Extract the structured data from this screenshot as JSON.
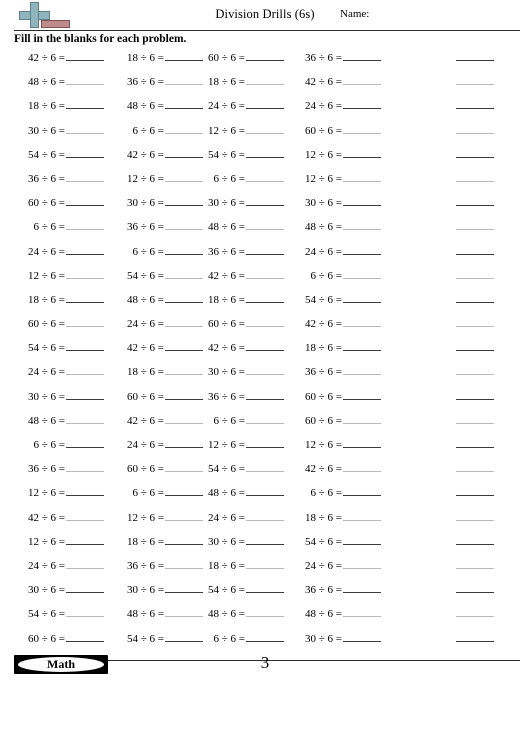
{
  "header": {
    "title": "Division Drills (6s)",
    "name_label": "Name:",
    "logo": {
      "plus_icon": "plus-icon",
      "minus_icon": "minus-icon",
      "plus_color": "#8fb6bd",
      "minus_color": "#c08a8a"
    }
  },
  "instructions": "Fill in the blanks for each problem.",
  "worksheet": {
    "operator": "÷",
    "divisor": 6,
    "columns": 5,
    "rows": 25,
    "column_dividends": [
      [
        42,
        48,
        18,
        30,
        54,
        36,
        60,
        6,
        24,
        12,
        18,
        60,
        54,
        24,
        30,
        48,
        6,
        36,
        12,
        42,
        12,
        24,
        30,
        54,
        60
      ],
      [
        18,
        36,
        48,
        6,
        42,
        12,
        30,
        36,
        6,
        54,
        48,
        24,
        42,
        18,
        60,
        42,
        24,
        60,
        6,
        12,
        18,
        36,
        30,
        48,
        54
      ],
      [
        60,
        18,
        24,
        12,
        54,
        6,
        30,
        48,
        36,
        42,
        18,
        60,
        42,
        30,
        36,
        6,
        12,
        54,
        48,
        24,
        30,
        18,
        54,
        48,
        6
      ],
      [
        36,
        42,
        24,
        60,
        12,
        12,
        30,
        48,
        24,
        6,
        54,
        42,
        18,
        36,
        60,
        60,
        12,
        42,
        6,
        18,
        54,
        24,
        36,
        48,
        30
      ],
      [
        null,
        null,
        null,
        null,
        null,
        null,
        null,
        null,
        null,
        null,
        null,
        null,
        null,
        null,
        null,
        null,
        null,
        null,
        null,
        null,
        null,
        null,
        null,
        null,
        null
      ]
    ]
  },
  "footer": {
    "badge_label": "Math",
    "page_number": "3"
  }
}
